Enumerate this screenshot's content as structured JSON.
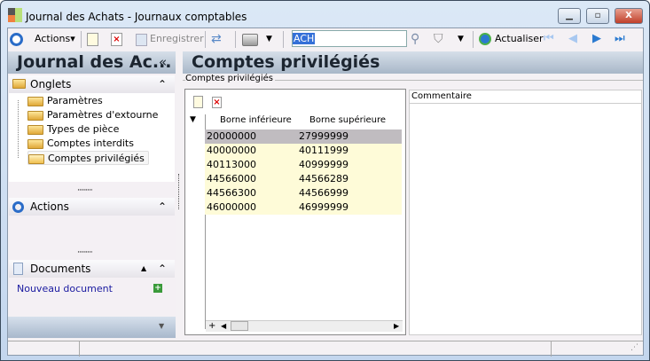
{
  "window": {
    "title": "Journal des Achats - Journaux comptables"
  },
  "toolbar": {
    "actions": "Actions",
    "save": "Enregistrer",
    "search_value": "ACH",
    "refresh": "Actualiser"
  },
  "left": {
    "title": "Journal des Ac...",
    "collapse": "«",
    "onglets": {
      "label": "Onglets",
      "items": [
        "Paramètres",
        "Paramètres d'extourne",
        "Types de pièce",
        "Comptes interdits",
        "Comptes privilégiés"
      ]
    },
    "actions": {
      "label": "Actions"
    },
    "documents": {
      "label": "Documents",
      "new_doc": "Nouveau document"
    }
  },
  "main": {
    "title": "Comptes privilégiés",
    "group_label": "Comptes privilégiés",
    "grid": {
      "columns": [
        "Borne inférieure",
        "Borne supérieure"
      ],
      "rows": [
        [
          "20000000",
          "27999999"
        ],
        [
          "40000000",
          "40111999"
        ],
        [
          "40113000",
          "40999999"
        ],
        [
          "44566000",
          "44566289"
        ],
        [
          "44566300",
          "44566999"
        ],
        [
          "46000000",
          "46999999"
        ]
      ]
    },
    "comment_label": "Commentaire"
  }
}
